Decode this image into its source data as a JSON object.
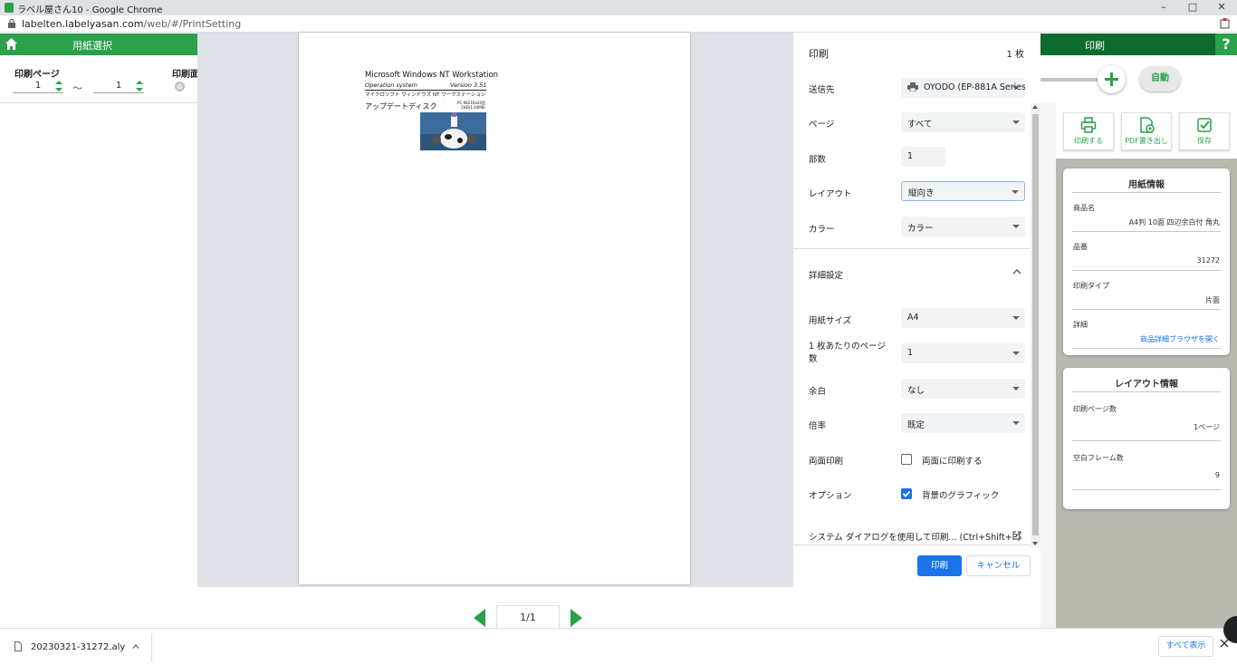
{
  "browser": {
    "window_title": "ラベル屋さん10 - Google Chrome",
    "url_host": "labelten.labelyasan.com",
    "url_path": "/web/#/PrintSetting",
    "controls": {
      "minimize": "–",
      "maximize": "□",
      "close": "✕"
    }
  },
  "app": {
    "paper_select_label": "用紙選択",
    "print_tab_label": "印刷",
    "help_label": "?",
    "print_page_label": "印刷ページ",
    "page_from": "1",
    "page_tilde": "～",
    "page_to": "1",
    "print_face_label": "印刷面",
    "auto_label": "自動",
    "actions": {
      "print": "印刷する",
      "pdf": "PDF書き出し",
      "save": "保存"
    },
    "paper_info": {
      "title": "用紙情報",
      "rows": [
        {
          "key": "商品名",
          "value": "A4判 10面 四辺余白付 角丸"
        },
        {
          "key": "品番",
          "value": "31272"
        },
        {
          "key": "印刷タイプ",
          "value": "片面"
        },
        {
          "key": "詳細",
          "value": "商品詳細ブラウザを開く"
        }
      ]
    },
    "layout_info": {
      "title": "レイアウト情報",
      "rows": [
        {
          "key": "印刷ページ数",
          "value": "1ページ"
        },
        {
          "key": "空白フレーム数",
          "value": "9"
        }
      ]
    },
    "pager": "1/1"
  },
  "preview_label": {
    "title": "Microsoft Windows NT Workstation",
    "operation": "Operation system",
    "version": "Version 3.51",
    "japanese": "マイクロソフト ウィンドウズ NT ワークステーション",
    "update": "アップデートディスク",
    "pc_line1": "PC-9821Ra20型",
    "pc_line2": "2HD(1.44MB)"
  },
  "print_dialog": {
    "title": "印刷",
    "sheet_count": "1 枚",
    "destination": {
      "label": "送信先",
      "value": "OYODO (EP-881A Series)"
    },
    "pages": {
      "label": "ページ",
      "value": "すべて"
    },
    "copies": {
      "label": "部数",
      "value": "1"
    },
    "layout": {
      "label": "レイアウト",
      "value": "縦向き"
    },
    "color": {
      "label": "カラー",
      "value": "カラー"
    },
    "details": {
      "label": "詳細設定"
    },
    "paper_size": {
      "label": "用紙サイズ",
      "value": "A4"
    },
    "pages_per_sheet": {
      "label": "1 枚あたりのページ数",
      "value": "1"
    },
    "margins": {
      "label": "余白",
      "value": "なし"
    },
    "scale": {
      "label": "倍率",
      "value": "既定"
    },
    "duplex": {
      "label": "両面印刷",
      "option": "両面に印刷する",
      "checked": false
    },
    "options": {
      "label": "オプション",
      "option": "背景のグラフィック",
      "checked": true
    },
    "system_dialog": "システム ダイアログを使用して印刷... (Ctrl+Shift+P)",
    "print_button": "印刷",
    "cancel_button": "キャンセル"
  },
  "download_bar": {
    "file_name": "20230321-31272.aly",
    "show_all": "すべて表示"
  },
  "colors": {
    "app_green": "#2aa14a",
    "dark_green": "#0e6b2e",
    "chrome_blue": "#1a73e8"
  }
}
